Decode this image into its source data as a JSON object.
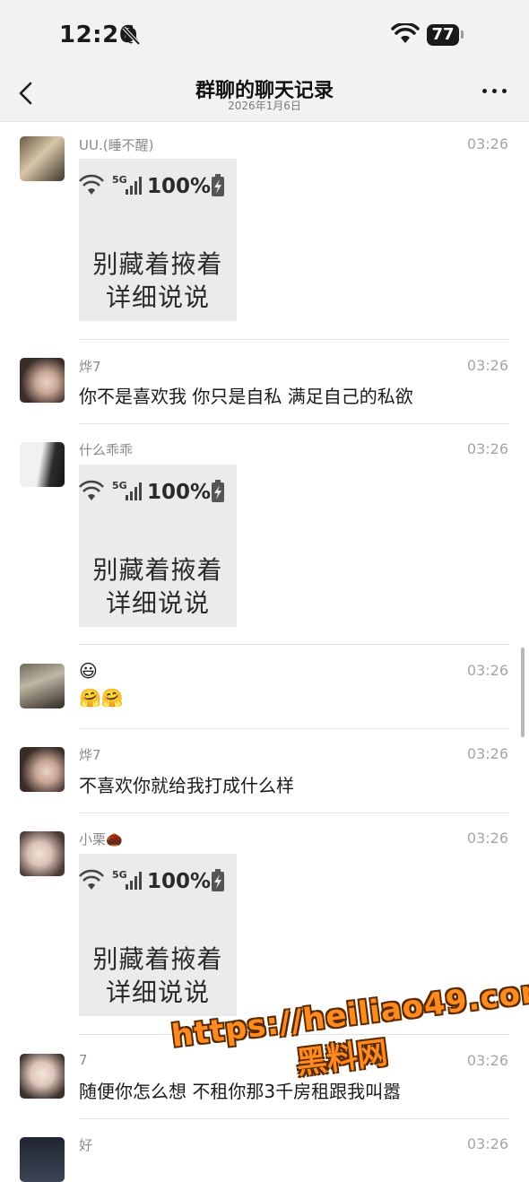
{
  "status_bar": {
    "time": "12:26",
    "battery": "77"
  },
  "header": {
    "title": "群聊的聊天记录",
    "date": "2026年1月6日"
  },
  "sticker": {
    "percent": "100%",
    "line1": "别藏着掖着",
    "line2": "详细说说"
  },
  "messages": [
    {
      "sender": "UU.(睡不醒)",
      "time": "03:26",
      "type": "sticker"
    },
    {
      "sender": "烨7",
      "time": "03:26",
      "type": "text",
      "text": "你不是喜欢我 你只是自私 满足自己的私欲"
    },
    {
      "sender": "什么乖乖",
      "time": "03:26",
      "type": "sticker"
    },
    {
      "sender": "",
      "time": "03:26",
      "type": "emoji",
      "line1": "😃",
      "line2": "🤗🤗"
    },
    {
      "sender": "烨7",
      "time": "03:26",
      "type": "text",
      "text": "不喜欢你就给我打成什么样"
    },
    {
      "sender": "小栗🌰",
      "time": "03:26",
      "type": "sticker"
    },
    {
      "sender": "7",
      "time": "03:26",
      "type": "text",
      "text": "随便你怎么想 不租你那3千房租跟我叫嚣"
    },
    {
      "sender": "好",
      "time": "03:26",
      "type": "text",
      "text": ""
    }
  ],
  "watermark": {
    "url": "https://heiliao49.com",
    "name": "黑料网"
  }
}
